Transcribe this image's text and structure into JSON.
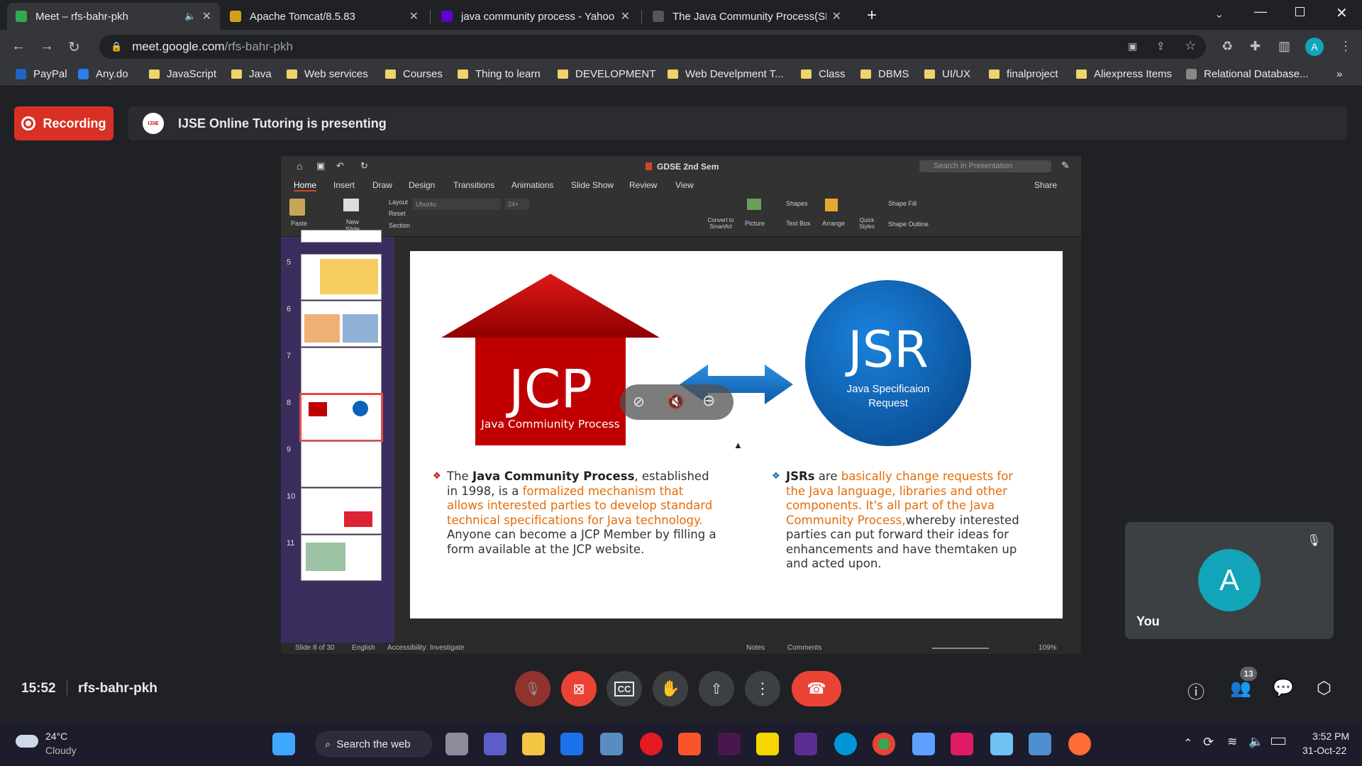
{
  "tabs": [
    {
      "title": "Meet – rfs-bahr-pkh",
      "fav": "#34a853"
    },
    {
      "title": "Apache Tomcat/8.5.83",
      "fav": "#d4a017"
    },
    {
      "title": "java community process - Yahoo",
      "fav": "#6001d2"
    },
    {
      "title": "The Java Community Process(SM",
      "fav": "#555555"
    }
  ],
  "address": {
    "host": "meet.google.com",
    "path": "/rfs-bahr-pkh"
  },
  "profile_initial": "A",
  "bookmarks": [
    "PayPal",
    "Any.do",
    "JavaScript",
    "Java",
    "Web services",
    "Courses",
    "Thing to learn",
    "DEVELOPMENT",
    "Web Develpment T...",
    "Class",
    "DBMS",
    "UI/UX",
    "finalproject",
    "Aliexpress Items",
    "Relational Database..."
  ],
  "meet": {
    "recording": "Recording",
    "presenting": "IJSE Online Tutoring is presenting",
    "time": "15:52",
    "code": "rfs-bahr-pkh",
    "people_count": "13",
    "you_label": "You",
    "you_initial": "A"
  },
  "ppt": {
    "title": "GDSE 2nd Sem",
    "search_placeholder": "Search in Presentation",
    "share": "Share",
    "tabs": [
      "Home",
      "Insert",
      "Draw",
      "Design",
      "Transitions",
      "Animations",
      "Slide Show",
      "Review",
      "View"
    ],
    "font": "Ubuntu",
    "font_size": "24+",
    "ribbon": {
      "paste": "Paste",
      "new_slide": "New Slide",
      "layout": "Layout",
      "reset": "Reset",
      "section": "Section",
      "convert": "Convert to SmartArt",
      "picture": "Picture",
      "shapes": "Shapes",
      "textbox": "Text Box",
      "arrange": "Arrange",
      "quick": "Quick Styles",
      "fill": "Shape Fill",
      "outline": "Shape Outline"
    },
    "thumb_numbers": [
      "5",
      "6",
      "7",
      "8",
      "9",
      "10",
      "11"
    ],
    "status": {
      "slide": "Slide 8 of 30",
      "lang": "English",
      "access": "Accessibility: Investigate",
      "notes": "Notes",
      "comments": "Comments",
      "zoom": "109%"
    }
  },
  "slide": {
    "jcp": "JCP",
    "jcp_sub": "Java Commiunity Process",
    "jsr": "JSR",
    "jsr_sub1": "Java Specificaion",
    "jsr_sub2": "Request",
    "left_1": "The ",
    "left_b": "Java Community Process",
    "left_2": ", established in 1998, is a ",
    "left_or": "formalized mechanism that allows interested parties to develop standard technical specifications for Java technology.",
    "left_3": " Anyone can become a JCP Member by filling a form available at the JCP website.",
    "right_b": "JSRs",
    "right_1": " are ",
    "right_or": "basically change requests for the Java language, libraries and other components. It's all part of the Java Community Process,",
    "right_2": "whereby interested parties can put forward their ideas for enhancements and have themtaken up and acted upon."
  },
  "weather": {
    "temp": "24°C",
    "desc": "Cloudy"
  },
  "search": "Search the web",
  "clock": {
    "time": "3:52 PM",
    "date": "31-Oct-22"
  },
  "colors": {
    "meet_bg": "#202124",
    "rec": "#d93025",
    "jcp_red": "#c00000",
    "jsr_blue": "#0a63b8",
    "accent_orange": "#e46c0a",
    "avatar": "#12a4b8"
  }
}
